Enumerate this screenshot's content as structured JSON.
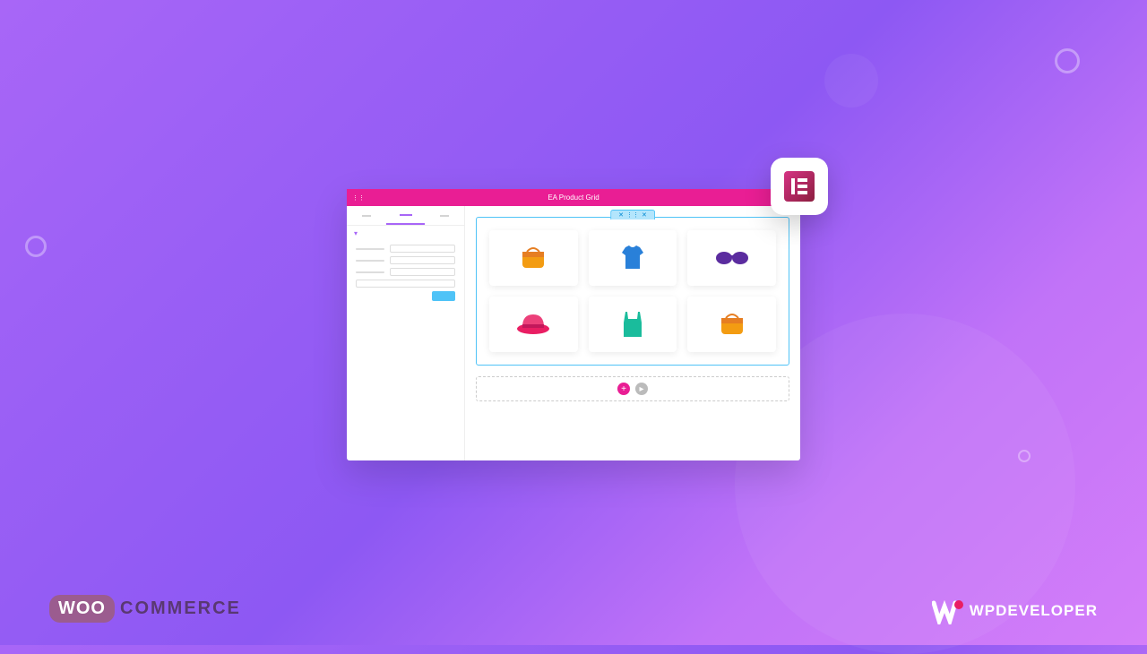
{
  "window": {
    "title": "EA Product Grid"
  },
  "section_handle": {
    "close": "✕",
    "grip": "⋮⋮",
    "x": "✕"
  },
  "filter": {
    "caret": "▾"
  },
  "add": {
    "plus": "+",
    "play": "▸"
  },
  "products": [
    {
      "name": "handbag-orange",
      "icon": "handbag"
    },
    {
      "name": "tshirt-blue",
      "icon": "tshirt"
    },
    {
      "name": "sunglasses-purple",
      "icon": "sunglasses"
    },
    {
      "name": "hat-pink",
      "icon": "hat"
    },
    {
      "name": "tanktop-teal",
      "icon": "tanktop"
    },
    {
      "name": "handbag-orange-2",
      "icon": "handbag"
    }
  ],
  "elementor": {
    "label": "E"
  },
  "logos": {
    "woo": "WOO",
    "commerce": "COMMERCE",
    "wpdev": "WPDEVELOPER"
  }
}
